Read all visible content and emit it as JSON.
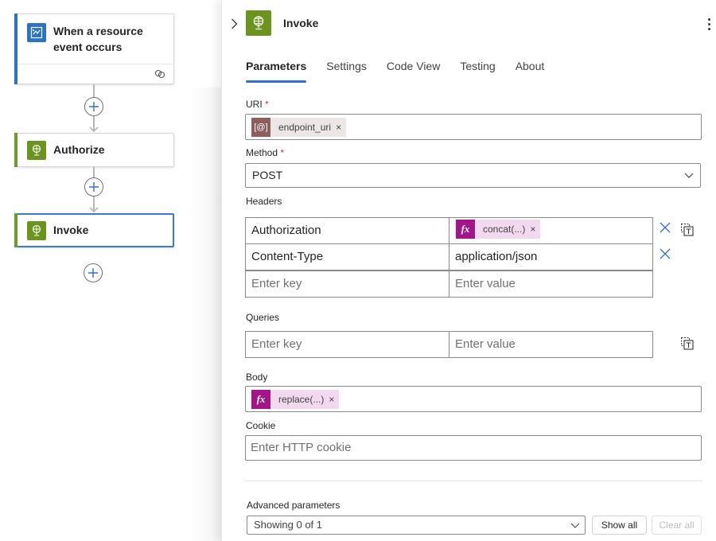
{
  "canvas": {
    "nodes": [
      {
        "title": "When a resource event occurs",
        "type": "trigger",
        "icon": "event-grid-icon",
        "accent_color": "#2a73c9"
      },
      {
        "title": "Authorize",
        "type": "action",
        "icon": "http-globe-icon",
        "accent_color": "#6f9b2a"
      },
      {
        "title": "Invoke",
        "type": "action",
        "icon": "http-globe-icon",
        "accent_color": "#6f9b2a",
        "selected": true
      }
    ]
  },
  "panel": {
    "title": "Invoke",
    "icon": "http-globe-icon",
    "tabs": [
      {
        "label": "Parameters",
        "active": true
      },
      {
        "label": "Settings"
      },
      {
        "label": "Code View"
      },
      {
        "label": "Testing"
      },
      {
        "label": "About"
      }
    ],
    "uri": {
      "label": "URI",
      "required_mark": "*",
      "token": {
        "text": "endpoint_uri",
        "icon": "variable-icon",
        "icon_text": "[@]",
        "remove": "×"
      }
    },
    "method": {
      "label": "Method",
      "required_mark": "*",
      "value": "POST"
    },
    "headers": {
      "label": "Headers",
      "rows": [
        {
          "key": "Authorization",
          "value_token": {
            "text": "concat(...)",
            "icon_text": "fx",
            "remove": "×"
          }
        },
        {
          "key": "Content-Type",
          "value": "application/json"
        }
      ],
      "key_placeholder": "Enter key",
      "value_placeholder": "Enter value"
    },
    "queries": {
      "label": "Queries",
      "key_placeholder": "Enter key",
      "value_placeholder": "Enter value"
    },
    "body": {
      "label": "Body",
      "token": {
        "text": "replace(...)",
        "icon_text": "fx",
        "remove": "×"
      }
    },
    "cookie": {
      "label": "Cookie",
      "placeholder": "Enter HTTP cookie"
    },
    "advanced": {
      "label": "Advanced parameters",
      "value": "Showing 0 of 1",
      "show_all": "Show all",
      "clear_all": "Clear all"
    }
  },
  "colors": {
    "accent_blue": "#2f6fd1",
    "trigger_blue": "#2a73c9",
    "action_green": "#6b941f",
    "fx_magenta": "#a4148a",
    "variable_brown": "#8d5e5e",
    "required_red": "#c4314b"
  }
}
